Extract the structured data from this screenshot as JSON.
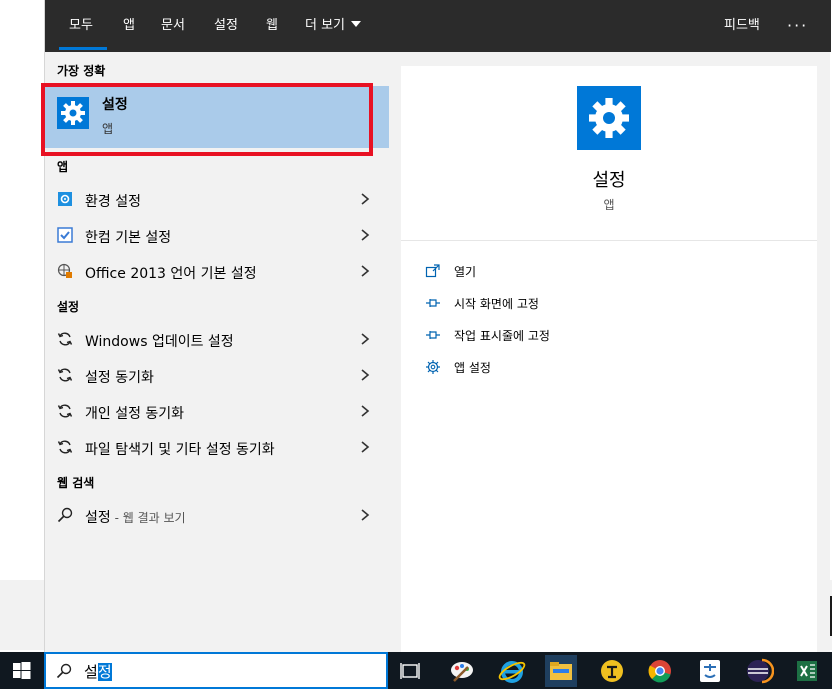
{
  "tabs": [
    {
      "label": "모두"
    },
    {
      "label": "앱"
    },
    {
      "label": "문서"
    },
    {
      "label": "설정"
    },
    {
      "label": "웹"
    },
    {
      "label": "더 보기"
    }
  ],
  "feedback_label": "피드백",
  "more_options": "···",
  "best_match": {
    "section_label": "가장 정확",
    "title": "설정",
    "subtitle": "앱",
    "icon": "gear-icon"
  },
  "apps_section": {
    "label": "앱",
    "items": [
      {
        "label": "환경 설정",
        "icon": "control-panel-icon"
      },
      {
        "label": "한컴 기본 설정",
        "icon": "hancom-check-icon"
      },
      {
        "label": "Office 2013 언어 기본 설정",
        "icon": "globe-language-icon"
      }
    ]
  },
  "settings_section": {
    "label": "설정",
    "items": [
      {
        "label": "Windows 업데이트 설정",
        "icon": "sync-icon"
      },
      {
        "label": "설정 동기화",
        "icon": "sync-icon"
      },
      {
        "label": "개인 설정 동기화",
        "icon": "sync-icon"
      },
      {
        "label": "파일 탐색기 및 기타 설정 동기화",
        "icon": "sync-icon"
      }
    ]
  },
  "web_section": {
    "label": "웹 검색",
    "item": {
      "label": "설정",
      "suffix": " - 웹 결과 보기",
      "icon": "search-icon"
    }
  },
  "preview": {
    "title": "설정",
    "subtitle": "앱",
    "actions": [
      {
        "label": "열기",
        "icon": "open-icon"
      },
      {
        "label": "시작 화면에 고정",
        "icon": "pin-icon"
      },
      {
        "label": "작업 표시줄에 고정",
        "icon": "pin-icon"
      },
      {
        "label": "앱 설정",
        "icon": "gear-icon"
      }
    ]
  },
  "search": {
    "value_prefix": "설",
    "value_selected": "정"
  },
  "colors": {
    "accent": "#0078d7",
    "highlight": "#aacbea",
    "topbar": "#2b2b2b",
    "taskbar": "#101820",
    "annotation_red": "#e81123"
  }
}
